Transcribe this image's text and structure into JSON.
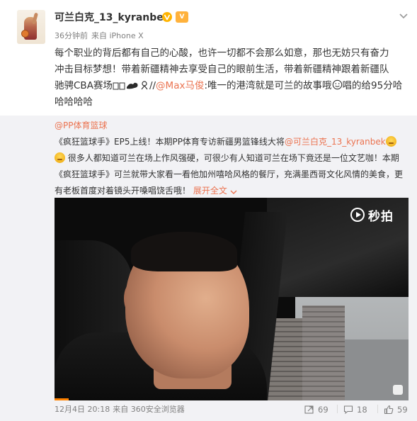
{
  "post": {
    "username": "可兰白克_13_kyranbek",
    "vip_badge_text": "V",
    "time": "36分钟前",
    "source": "来自 iPhone X",
    "text_line1": "每个职业的背后都有自己的心酸，也许一切都不会那么如意，那也无妨只有奋力",
    "text_line2": "冲击目标梦想！带着新疆精神去享受自己的眼前生活，带着新疆精神跟着新疆队",
    "text_line3a": "驰骋CBA赛场",
    "text_line3_sep": "//",
    "mention": "@Max马俊",
    "text_line3b": ":唯一的港湾就是可兰的故事哦",
    "text_line3c": "唱的给95分哈",
    "text_line4": "哈哈哈哈"
  },
  "repost": {
    "author": "@PP体育篮球",
    "line1a": "《疯狂篮球手》EP5上线！本期PP体育专访新疆男篮锋线大将",
    "line1_mention": "@可兰白克_13_kyranbek",
    "line2": "很多人都知道可兰在场上作风强硬，可很少有人知道可兰在场下竟还是一位文艺咖！本期",
    "line3": "《疯狂篮球手》可兰就带大家看一看他加州嘻哈风格的餐厅，充满墨西哥文化风情的美食，更",
    "line4": "有老板首度对着镜头开嗓唱饶舌哦！",
    "expand_label": "展开全文",
    "video_brand": "秒拍",
    "time": "12月4日 20:18",
    "source": "来自 360安全浏览器",
    "repost_count": "69",
    "comment_count": "18",
    "like_count": "59"
  },
  "colors": {
    "link": "#eb7350",
    "meta": "#808080",
    "repost_bg": "#f2f2f5",
    "progress": "#ff8200"
  }
}
